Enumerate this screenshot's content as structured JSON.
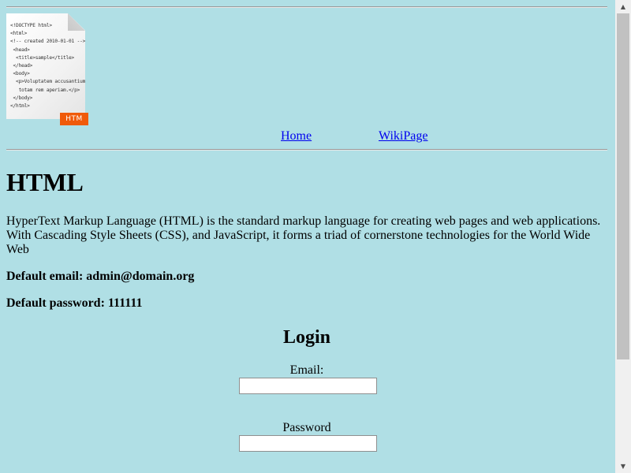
{
  "header": {
    "logo": {
      "icon": "html-file-icon",
      "code_lines": [
        "<!DOCTYPE html>",
        "<html>",
        "<!-- created 2010-01-01 -->",
        " <head>",
        "  <title>sample</title>",
        " </head>",
        " <body>",
        "  <p>Voluptatem accusantium",
        "   totam rem aperiam.</p>",
        " </body>",
        "</html>"
      ],
      "badge": "HTM"
    },
    "nav": {
      "home": "Home",
      "wiki": "WikiPage"
    }
  },
  "main": {
    "title": "HTML",
    "description": "HyperText Markup Language (HTML) is the standard markup language for creating web pages and web applications. With Cascading Style Sheets (CSS), and JavaScript, it forms a triad of cornerstone technologies for the World Wide Web",
    "default_email": "Default email: admin@domain.org",
    "default_password": "Default password: 111111"
  },
  "login": {
    "heading": "Login",
    "email_label": "Email:",
    "email_value": "",
    "password_label": "Password",
    "password_value": ""
  },
  "colors": {
    "background": "#b0dfe5",
    "link": "#0000ee",
    "badge": "#f05a0a"
  }
}
